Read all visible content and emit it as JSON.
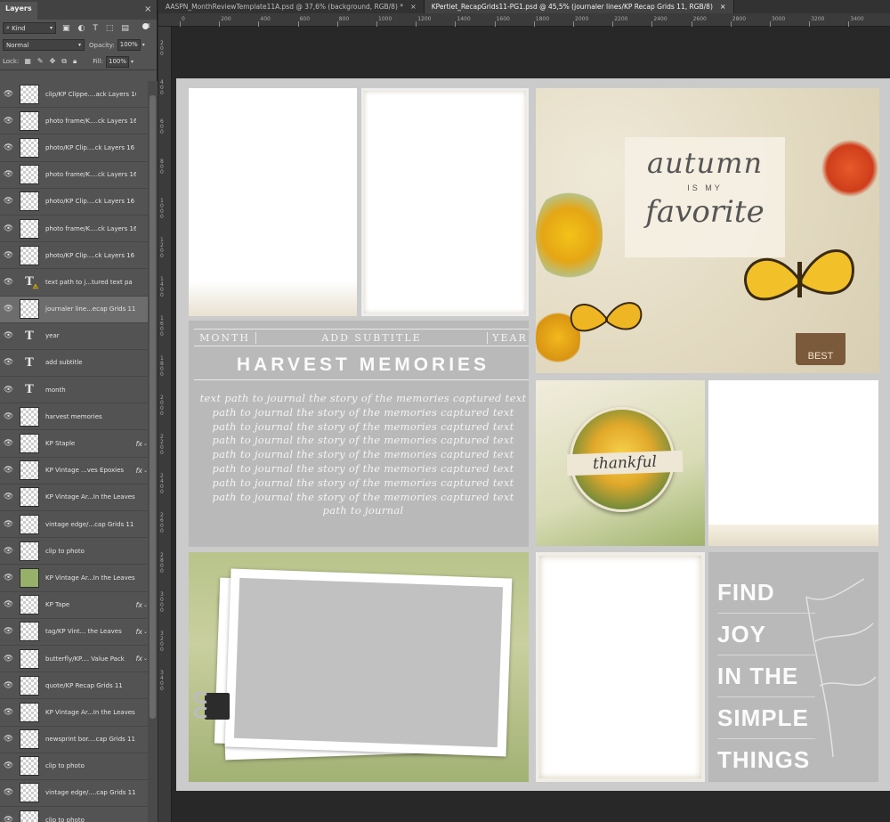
{
  "layers_panel": {
    "tab_label": "Layers",
    "close": "×",
    "menu": "≡",
    "filter_kind": "Kind",
    "blend_mode": "Normal",
    "opacity_label": "Opacity:",
    "opacity_value": "100%",
    "lock_label": "Lock:",
    "fill_label": "Fill:",
    "fill_value": "100%",
    "layers": [
      {
        "name": "clip/KP Clippe....ack Layers 16",
        "kind": "pixel",
        "fx": false,
        "selected": false
      },
      {
        "name": "photo frame/K....ck Layers 16",
        "kind": "pixel",
        "fx": false,
        "selected": false
      },
      {
        "name": "photo/KP Clip....ck Layers 16",
        "kind": "pixel",
        "fx": false,
        "selected": false
      },
      {
        "name": "photo frame/K....ck Layers 16",
        "kind": "pixel",
        "fx": false,
        "selected": false
      },
      {
        "name": "photo/KP Clip....ck Layers 16",
        "kind": "pixel",
        "fx": false,
        "selected": false
      },
      {
        "name": "photo frame/K....ck Layers 16",
        "kind": "pixel",
        "fx": false,
        "selected": false
      },
      {
        "name": "photo/KP Clip....ck Layers 16",
        "kind": "pixel",
        "fx": false,
        "selected": false
      },
      {
        "name": "text path to j...tured text pa",
        "kind": "text-warn",
        "fx": false,
        "selected": false
      },
      {
        "name": "journaler line...ecap Grids 11",
        "kind": "pixel",
        "fx": false,
        "selected": true
      },
      {
        "name": "year",
        "kind": "text",
        "fx": false,
        "selected": false
      },
      {
        "name": "add subtitle",
        "kind": "text",
        "fx": false,
        "selected": false
      },
      {
        "name": "month",
        "kind": "text",
        "fx": false,
        "selected": false
      },
      {
        "name": "harvest memories",
        "kind": "pixel",
        "fx": false,
        "selected": false
      },
      {
        "name": "KP Staple",
        "kind": "pixel",
        "fx": true,
        "selected": false
      },
      {
        "name": "KP Vintage ...ves Epoxies",
        "kind": "pixel",
        "fx": true,
        "selected": false
      },
      {
        "name": "KP Vintage Ar...In the Leaves",
        "kind": "pixel",
        "fx": false,
        "selected": false
      },
      {
        "name": "vintage edge/...cap Grids 11",
        "kind": "pixel",
        "fx": false,
        "selected": false
      },
      {
        "name": "clip to photo",
        "kind": "pixel",
        "fx": false,
        "selected": false
      },
      {
        "name": "KP Vintage Ar...In the Leaves",
        "kind": "green",
        "fx": false,
        "selected": false
      },
      {
        "name": "KP Tape",
        "kind": "pixel",
        "fx": true,
        "selected": false
      },
      {
        "name": "tag/KP Vint... the Leaves",
        "kind": "pixel",
        "fx": true,
        "selected": false
      },
      {
        "name": "butterfly/KP.... Value Pack",
        "kind": "pixel",
        "fx": true,
        "selected": false
      },
      {
        "name": "quote/KP Recap Grids 11",
        "kind": "pixel",
        "fx": false,
        "selected": false
      },
      {
        "name": "KP Vintage Ar...In the Leaves",
        "kind": "pixel",
        "fx": false,
        "selected": false
      },
      {
        "name": "newsprint bor....cap Grids 11",
        "kind": "pixel",
        "fx": false,
        "selected": false
      },
      {
        "name": "clip to photo",
        "kind": "pixel",
        "fx": false,
        "selected": false
      },
      {
        "name": "vintage edge/....cap Grids 11",
        "kind": "pixel",
        "fx": false,
        "selected": false
      },
      {
        "name": "clip to photo",
        "kind": "pixel",
        "fx": false,
        "selected": false
      }
    ]
  },
  "doc_tabs": [
    {
      "label": "AASPN_MonthReviewTemplate11A.psd @ 37,6% (background, RGB/8) *",
      "active": false
    },
    {
      "label": "KPertiet_RecapGrids11-PG1.psd @ 45,5% (journaler lines/KP Recap Grids 11, RGB/8)",
      "active": true
    }
  ],
  "ruler_top": [
    "0",
    "200",
    "400",
    "600",
    "800",
    "1000",
    "1200",
    "1400",
    "1600",
    "1800",
    "2000",
    "2200",
    "2400",
    "2600",
    "2800",
    "3000",
    "3200",
    "3400"
  ],
  "ruler_left": [
    "2 0 0",
    "4 0 0",
    "6 0 0",
    "8 0 0",
    "1 0 0 0",
    "1 2 0 0",
    "1 4 0 0",
    "1 6 0 0",
    "1 8 0 0",
    "2 0 0 0",
    "2 2 0 0",
    "2 4 0 0",
    "2 6 0 0",
    "2 8 0 0",
    "3 0 0 0",
    "3 2 0 0",
    "3 4 0 0"
  ],
  "canvas": {
    "subtitle": {
      "month": "MONTH",
      "add_subtitle": "ADD SUBTITLE",
      "year": "YEAR"
    },
    "title": "HARVEST MEMORIES",
    "journal_text": "text path to journal the story of the memories captured text path to journal the story of the memories captured text path to journal the story of the memories captured text path to journal the story of the memories captured text path to journal the story of the memories captured text path to journal the story of the memories captured text path to journal the story of the memories captured text path to journal the story of the memories captured text path to journal",
    "autumn": {
      "line1": "autumn",
      "line2": "IS MY",
      "line3": "favorite"
    },
    "best_tag": "BEST",
    "thankful": "thankful",
    "find_joy": [
      "FIND",
      "JOY",
      "IN THE",
      "SIMPLE",
      "THINGS"
    ],
    "colors": {
      "page_bg": "#cbcbcb",
      "panel_gray": "#b9b9b9",
      "workspace": "#282828"
    }
  }
}
